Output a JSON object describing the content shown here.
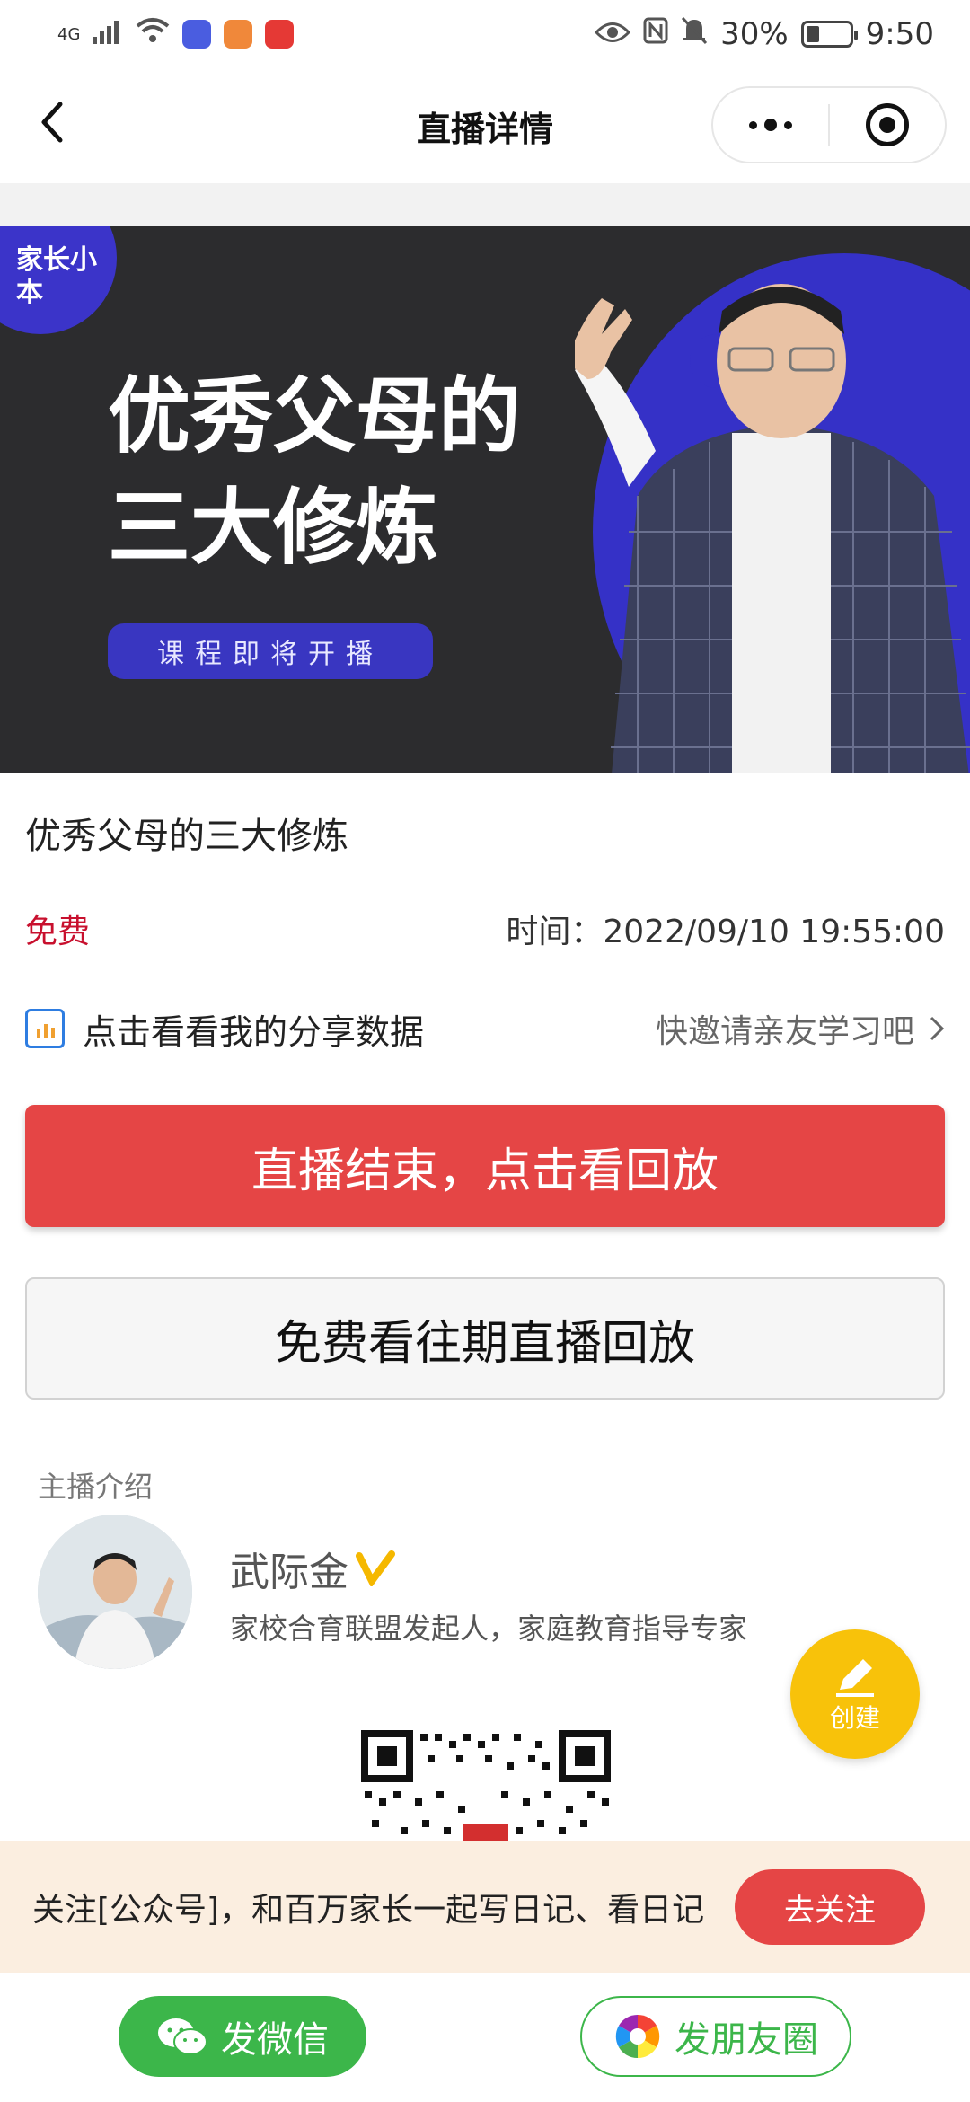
{
  "status_bar": {
    "network": "4G",
    "battery": "30%",
    "time": "9:50"
  },
  "nav": {
    "title": "直播详情"
  },
  "banner": {
    "brand": "家长小本",
    "headline": "优秀父母的三大修炼",
    "pill": "课程即将开播"
  },
  "course": {
    "title": "优秀父母的三大修炼",
    "price": "免费",
    "time": "时间：2022/09/10 19:55:00"
  },
  "share": {
    "left_label": "点击看看我的分享数据",
    "right_label": "快邀请亲友学习吧"
  },
  "buttons": {
    "replay": "直播结束，点击看回放",
    "past_replays": "免费看往期直播回放"
  },
  "host": {
    "section_label": "主播介绍",
    "name": "武际金",
    "description": "家校合育联盟发起人，家庭教育指导专家"
  },
  "fab": {
    "label": "创建"
  },
  "follow_bar": {
    "text": "关注[公众号]，和百万家长一起写日记、看日记",
    "button": "去关注"
  },
  "bottom": {
    "wechat": "发微信",
    "moments": "发朋友圈"
  },
  "colors": {
    "accent_red": "#e54545",
    "price_red": "#c8102e",
    "wechat_green": "#3cb64a",
    "banner_blue": "#3531c7",
    "fab_yellow": "#f8c20a"
  }
}
